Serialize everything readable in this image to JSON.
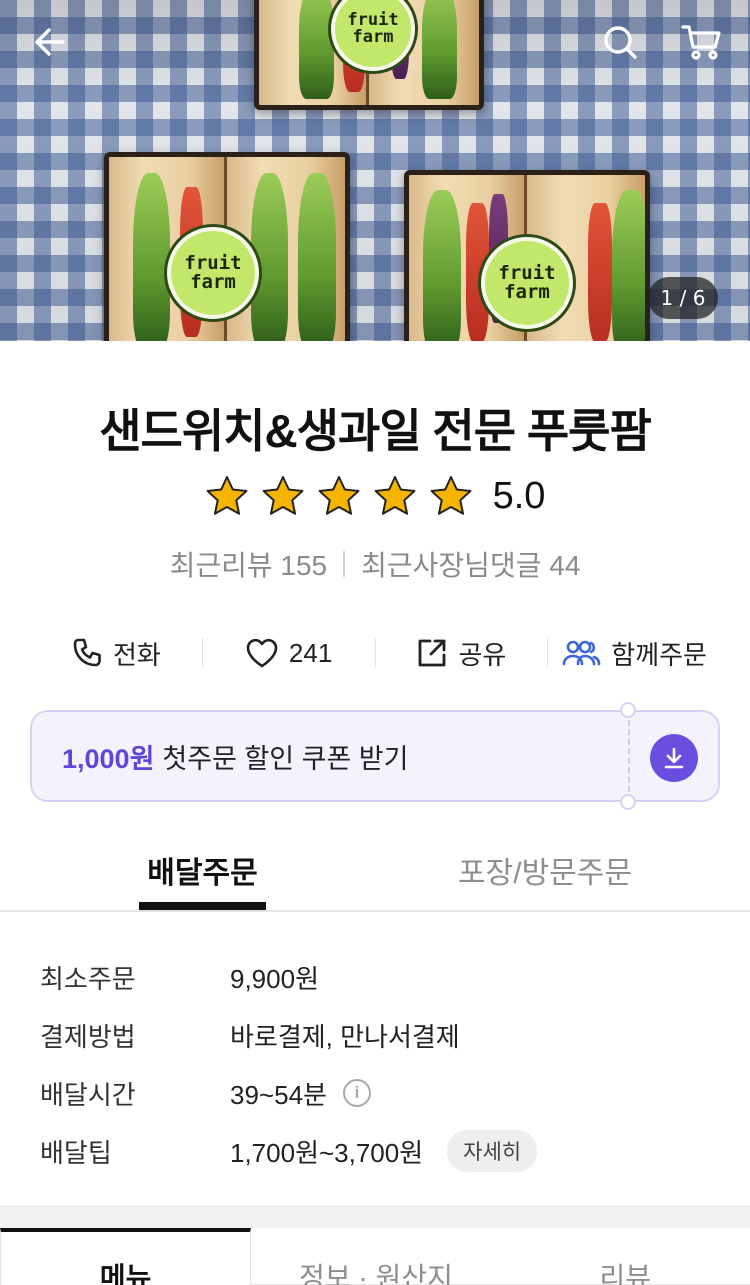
{
  "hero": {
    "photo_counter": "1 / 6",
    "sticker_line1": "fruit",
    "sticker_line2": "farm",
    "icons": [
      "back-arrow-icon",
      "search-icon",
      "cart-icon"
    ]
  },
  "store": {
    "title": "샌드위치&생과일 전문 푸룻팜",
    "rating": "5.0",
    "stars": 5,
    "recent_reviews": "최근리뷰 155",
    "owner_replies": "최근사장님댓글 44"
  },
  "actions": [
    {
      "label": "전화",
      "icon": "phone-icon"
    },
    {
      "label": "241",
      "icon": "heart-icon"
    },
    {
      "label": "공유",
      "icon": "share-icon"
    },
    {
      "label": "함께주문",
      "icon": "group-order-icon"
    }
  ],
  "coupon": {
    "amount": "1,000원",
    "text": "첫주문 할인 쿠폰 받기",
    "icon": "download-icon"
  },
  "order_tabs": {
    "delivery": "배달주문",
    "pickup": "포장/방문주문"
  },
  "info": {
    "min_order_label": "최소주문",
    "min_order_value": "9,900원",
    "payment_label": "결제방법",
    "payment_value": "바로결제, 만나서결제",
    "time_label": "배달시간",
    "time_value": "39~54분",
    "tip_label": "배달팁",
    "tip_value": "1,700원~3,700원",
    "tip_detail": "자세히"
  },
  "bottom_tabs": {
    "menu": "메뉴",
    "info": "정보 · 원산지",
    "review": "리뷰"
  },
  "colors": {
    "accent": "#6a4ee0",
    "coupon_bg": "#f4f2fd",
    "star": "#f5b400"
  }
}
